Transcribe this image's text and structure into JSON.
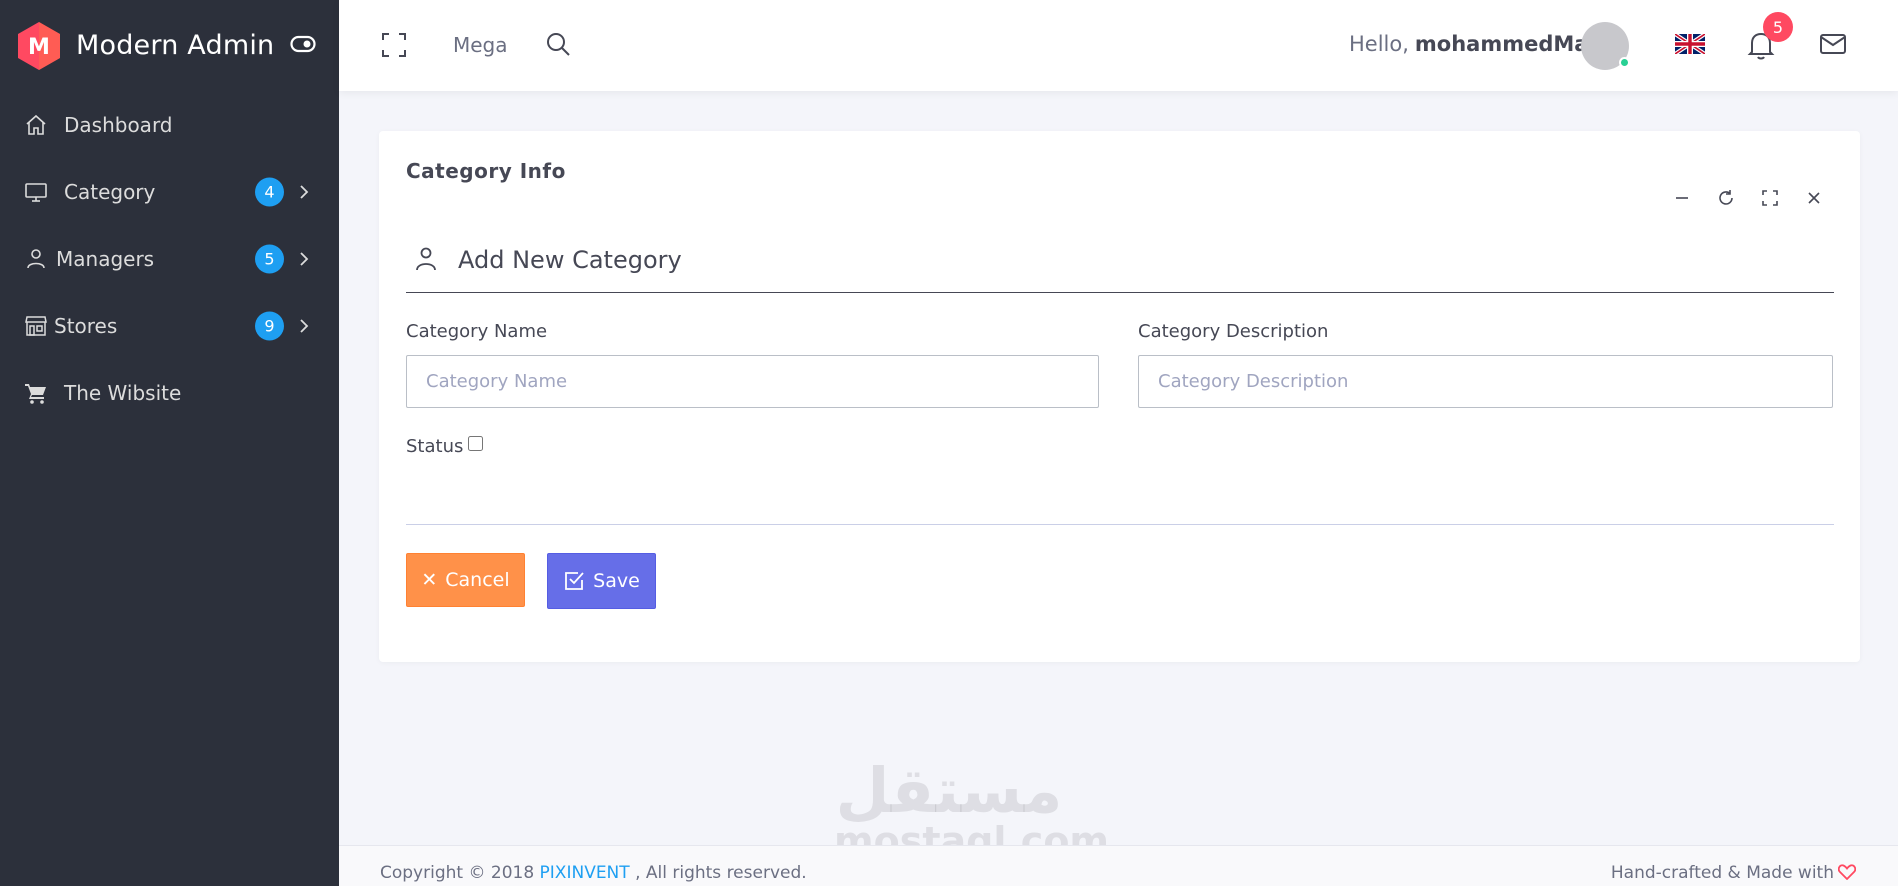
{
  "brand": {
    "logo_letter": "M",
    "name": "Modern Admin",
    "logo_color": "#ff4961"
  },
  "sidebar": {
    "items": [
      {
        "label": "Dashboard",
        "icon": "home-icon"
      },
      {
        "label": "Category",
        "icon": "monitor-icon",
        "badge": "4"
      },
      {
        "label": "Managers",
        "icon": "user-icon",
        "badge": "5"
      },
      {
        "label": "Stores",
        "icon": "store-icon",
        "badge": "9"
      },
      {
        "label": "The Wibsite",
        "icon": "cart-icon"
      }
    ]
  },
  "topbar": {
    "mega_label": "Mega",
    "hello": "Hello,",
    "username": "mohammedMaher",
    "notification_count": "5"
  },
  "card": {
    "title": "Category Info",
    "section_title": "Add New Category",
    "fields": {
      "name_label": "Category Name",
      "name_placeholder": "Category Name",
      "name_value": "",
      "desc_label": "Category Description",
      "desc_placeholder": "Category Description",
      "desc_value": ""
    },
    "status_label": "Status",
    "status_checked": false,
    "cancel_label": "Cancel",
    "save_label": "Save"
  },
  "watermark": {
    "line1": "مستقل",
    "line2": "mostaql.com"
  },
  "footer": {
    "copyright_prefix": "Copyright © 2018",
    "company": "PIXINVENT",
    "copyright_suffix": ", All rights reserved.",
    "right_text": "Hand-crafted & Made with"
  },
  "colors": {
    "sidebar_bg": "#2c303b",
    "badge_blue": "#1e9ff2",
    "cancel_orange": "#ff9149",
    "save_purple": "#666ee8",
    "notification_red": "#ff4961"
  }
}
